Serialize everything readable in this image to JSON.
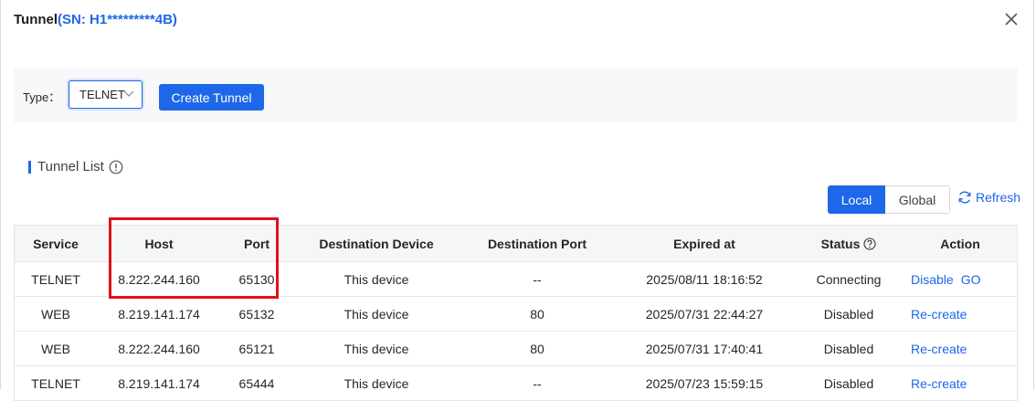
{
  "dialog": {
    "title": "Tunnel",
    "serial": "(SN: H1*********4B)"
  },
  "toolbar": {
    "type_label": "Type：",
    "type_value": "TELNET",
    "create_label": "Create Tunnel"
  },
  "section": {
    "title": "Tunnel List"
  },
  "scope": {
    "local": "Local",
    "global": "Global",
    "refresh": "Refresh"
  },
  "table": {
    "headers": {
      "service": "Service",
      "host": "Host",
      "port": "Port",
      "dest_device": "Destination Device",
      "dest_port": "Destination Port",
      "expired": "Expired at",
      "status": "Status",
      "action": "Action"
    },
    "rows": [
      {
        "service": "TELNET",
        "host": "8.222.244.160",
        "port": "65130",
        "dest_device": "This device",
        "dest_port": "--",
        "expired": "2025/08/11 18:16:52",
        "status": "Connecting",
        "actions": [
          "Disable",
          "GO"
        ]
      },
      {
        "service": "WEB",
        "host": "8.219.141.174",
        "port": "65132",
        "dest_device": "This device",
        "dest_port": "80",
        "expired": "2025/07/31 22:44:27",
        "status": "Disabled",
        "actions": [
          "Re-create"
        ]
      },
      {
        "service": "WEB",
        "host": "8.222.244.160",
        "port": "65121",
        "dest_device": "This device",
        "dest_port": "80",
        "expired": "2025/07/31 17:40:41",
        "status": "Disabled",
        "actions": [
          "Re-create"
        ]
      },
      {
        "service": "TELNET",
        "host": "8.219.141.174",
        "port": "65444",
        "dest_device": "This device",
        "dest_port": "--",
        "expired": "2025/07/23 15:59:15",
        "status": "Disabled",
        "actions": [
          "Re-create"
        ]
      }
    ]
  },
  "colors": {
    "accent": "#1d67e8",
    "highlight": "#e0101a"
  }
}
